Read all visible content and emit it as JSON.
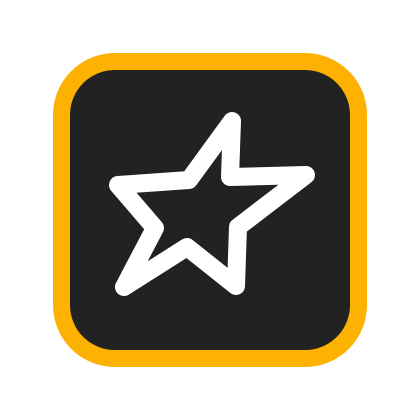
{
  "app_icon": {
    "icon": "star-outline-icon",
    "colors": {
      "frame": "#FDB100",
      "tile": "#222222",
      "glyph": "#FFFFFF",
      "page_background": "#FFFFFF"
    }
  }
}
